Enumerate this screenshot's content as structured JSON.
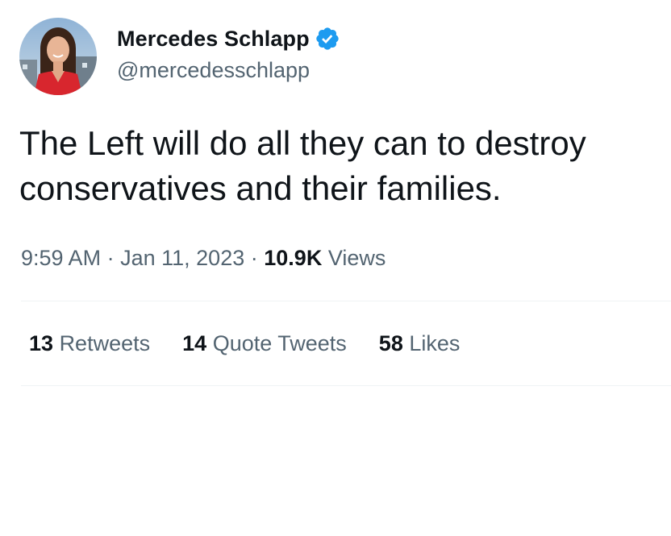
{
  "author": {
    "display_name": "Mercedes Schlapp",
    "handle": "@mercedesschlapp",
    "verified": true,
    "avatar_icon": "profile-photo"
  },
  "tweet": {
    "text": "The Left will do all they can to destroy\nconservatives and their families."
  },
  "meta": {
    "time": "9:59 AM",
    "separator": "·",
    "date": "Jan 11, 2023",
    "views_count": "10.9K",
    "views_label": "Views"
  },
  "stats": {
    "retweets_count": "13",
    "retweets_label": "Retweets",
    "quote_tweets_count": "14",
    "quote_tweets_label": "Quote Tweets",
    "likes_count": "58",
    "likes_label": "Likes"
  },
  "colors": {
    "text_primary": "#0f1419",
    "text_secondary": "#536471",
    "verified_blue": "#1d9bf0",
    "divider": "#eff3f4"
  }
}
